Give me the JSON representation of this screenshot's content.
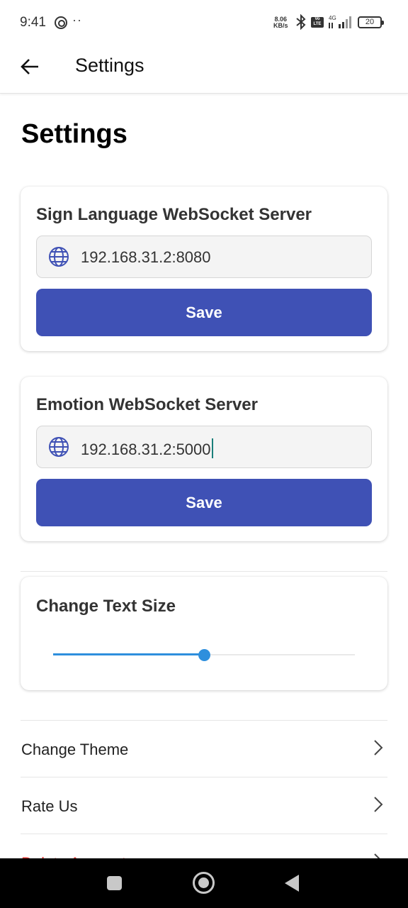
{
  "status_bar": {
    "time": "9:41",
    "dots": "··",
    "speed_value": "8.06",
    "speed_unit": "KB/s",
    "volte": "Vo LTE",
    "network": "4G",
    "battery": "20"
  },
  "app_bar": {
    "title": "Settings",
    "back_icon": "arrow-left-icon"
  },
  "page": {
    "heading": "Settings"
  },
  "sign_server": {
    "title": "Sign Language WebSocket Server",
    "value": "192.168.31.2:8080",
    "save_label": "Save"
  },
  "emotion_server": {
    "title": "Emotion WebSocket Server",
    "value": "192.168.31.2:5000",
    "save_label": "Save"
  },
  "text_size": {
    "title": "Change Text Size",
    "slider_value_fraction": 0.5
  },
  "menu": {
    "items": [
      {
        "label": "Change Theme"
      },
      {
        "label": "Rate Us"
      },
      {
        "label": "Delete Account"
      }
    ]
  },
  "colors": {
    "primary": "#3f51b5",
    "slider": "#2e8fdd",
    "danger": "#e53935"
  },
  "nav_bar": {
    "icons": [
      "recents-icon",
      "home-icon",
      "back-triangle-icon"
    ]
  }
}
